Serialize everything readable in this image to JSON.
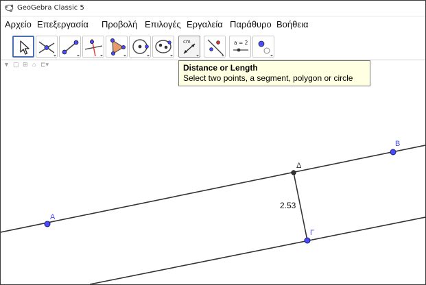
{
  "window": {
    "title": "GeoGebra Classic 5"
  },
  "menu": {
    "items": [
      "Αρχείο",
      "Επεξεργασία",
      "Προβολή",
      "Επιλογές",
      "Εργαλεία",
      "Παράθυρο",
      "Βοήθεια"
    ]
  },
  "toolbar": {
    "tools": [
      {
        "icon": "move-arrow-icon"
      },
      {
        "icon": "point-icon"
      },
      {
        "icon": "line-icon"
      },
      {
        "icon": "perpendicular-line-icon"
      },
      {
        "icon": "polygon-icon"
      },
      {
        "icon": "circle-center-point-icon"
      },
      {
        "icon": "ellipse-icon"
      },
      {
        "icon": "distance-icon",
        "label": "cm"
      },
      {
        "icon": "reflect-point-icon"
      },
      {
        "icon": "slider-icon",
        "label": "a = 2"
      },
      {
        "icon": "show-hide-icon"
      }
    ]
  },
  "tooltip": {
    "title": "Distance or Length",
    "description": "Select two points, a segment, polygon or circle"
  },
  "graphics": {
    "points": [
      {
        "name": "A",
        "color": "#4a4aff"
      },
      {
        "name": "B",
        "color": "#4a4aff"
      },
      {
        "name": "Γ",
        "color": "#4a4aff"
      },
      {
        "name": "Δ",
        "color": "#333333"
      }
    ],
    "distance_label": "2.53"
  },
  "colors": {
    "point_free": "#4a4aff",
    "point_dependent": "#333333",
    "line": "#333333",
    "tooltip_bg": "#ffffe1",
    "selected_tool_border": "#4a6fb5"
  }
}
